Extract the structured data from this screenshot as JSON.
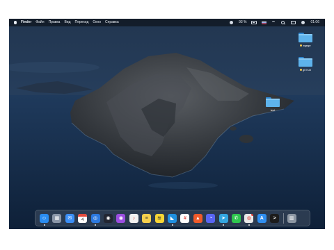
{
  "menubar": {
    "apple_icon": "apple-icon",
    "app_name": "Finder",
    "menus": [
      "Файл",
      "Правка",
      "Вид",
      "Переход",
      "Окно",
      "Справка"
    ],
    "status": {
      "battery_percent": "93 %",
      "time": "01:06"
    }
  },
  "desktop": {
    "items": [
      {
        "label": "egege",
        "tag_color": "#f5c84a"
      },
      {
        "label": "git hub",
        "tag_color": "#f5c84a"
      },
      {
        "label": "test"
      }
    ]
  },
  "dock": {
    "apps": [
      {
        "name": "finder",
        "color": "#2a8cf0"
      },
      {
        "name": "launchpad",
        "color": "#8a96a8"
      },
      {
        "name": "mail",
        "color": "#3b8ef5"
      },
      {
        "name": "calendar",
        "color": "#ffffff",
        "day": "4"
      },
      {
        "name": "safari",
        "color": "#2c79e0"
      },
      {
        "name": "github-desktop",
        "color": "#222632"
      },
      {
        "name": "podcasts",
        "color": "#9b4ee0"
      },
      {
        "name": "music",
        "color": "#f2f2f2"
      },
      {
        "name": "notes",
        "color": "#f6d04d"
      },
      {
        "name": "miro",
        "color": "#f7d535"
      },
      {
        "name": "vscode",
        "color": "#1f8fe0"
      },
      {
        "name": "slack",
        "color": "#ffffff"
      },
      {
        "name": "brave",
        "color": "#ef5a2a"
      },
      {
        "name": "discord",
        "color": "#5865f2"
      },
      {
        "name": "telegram",
        "color": "#33a6e0"
      },
      {
        "name": "whatsapp",
        "color": "#2ec74e"
      },
      {
        "name": "chrome",
        "color": "#e8e8e8",
        "badge": true
      },
      {
        "name": "app-store",
        "color": "#2f8ef0"
      },
      {
        "name": "terminal",
        "color": "#1c1c1c"
      },
      {
        "name": "trash",
        "color": "#8c96a2"
      }
    ]
  }
}
